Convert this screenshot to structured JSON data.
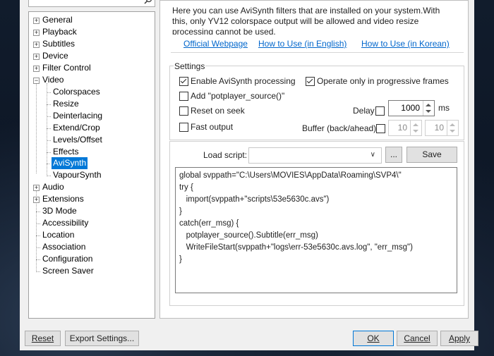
{
  "info": {
    "text": "Here you can use AviSynth filters that are installed on your system.With this, only YV12 colorspace output will be allowed and video resize processing cannot be used."
  },
  "links": {
    "official": "Official Webpage",
    "how_en": "How to Use (in English)",
    "how_kr": "How to Use (in Korean)"
  },
  "tree": {
    "items": [
      {
        "label": "General"
      },
      {
        "label": "Playback"
      },
      {
        "label": "Subtitles"
      },
      {
        "label": "Device"
      },
      {
        "label": "Filter Control"
      },
      {
        "label": "Video"
      },
      {
        "label": "Colorspaces"
      },
      {
        "label": "Resize"
      },
      {
        "label": "Deinterlacing"
      },
      {
        "label": "Extend/Crop"
      },
      {
        "label": "Levels/Offset"
      },
      {
        "label": "Effects"
      },
      {
        "label": "AviSynth"
      },
      {
        "label": "VapourSynth"
      },
      {
        "label": "Audio"
      },
      {
        "label": "Extensions"
      },
      {
        "label": "3D Mode"
      },
      {
        "label": "Accessibility"
      },
      {
        "label": "Location"
      },
      {
        "label": "Association"
      },
      {
        "label": "Configuration"
      },
      {
        "label": "Screen Saver"
      }
    ],
    "selected": "AviSynth"
  },
  "settings": {
    "title": "Settings",
    "enable_avisynth": {
      "label": "Enable AviSynth processing",
      "checked": true
    },
    "progressive_only": {
      "label": "Operate only in progressive frames",
      "checked": true
    },
    "add_source": {
      "label": "Add \"potplayer_source()\"",
      "checked": false
    },
    "reset_on_seek": {
      "label": "Reset on seek",
      "checked": false
    },
    "fast_output": {
      "label": "Fast output",
      "checked": false
    },
    "delay": {
      "label": "Delay",
      "checked": false,
      "value": "1000",
      "unit": "ms"
    },
    "buffer": {
      "label": "Buffer (back/ahead)",
      "checked": false,
      "back": "10",
      "ahead": "10"
    }
  },
  "script": {
    "load_label": "Load script:",
    "combo_value": "",
    "browse_label": "...",
    "save_label": "Save",
    "lines": [
      "global svppath=\"C:\\Users\\MOVIES\\AppData\\Roaming\\SVP4\\\"",
      "try {",
      "   import(svppath+\"scripts\\53e5630c.avs\")",
      "}",
      "catch(err_msg) {",
      "   potplayer_source().Subtitle(err_msg)",
      "   WriteFileStart(svppath+\"logs\\err-53e5630c.avs.log\", \"err_msg\")",
      "}"
    ]
  },
  "buttons": {
    "reset": "Reset",
    "export": "Export Settings...",
    "ok": "OK",
    "cancel": "Cancel",
    "apply": "Apply"
  },
  "colors": {
    "selection": "#0078d7",
    "link": "#0066cc"
  }
}
